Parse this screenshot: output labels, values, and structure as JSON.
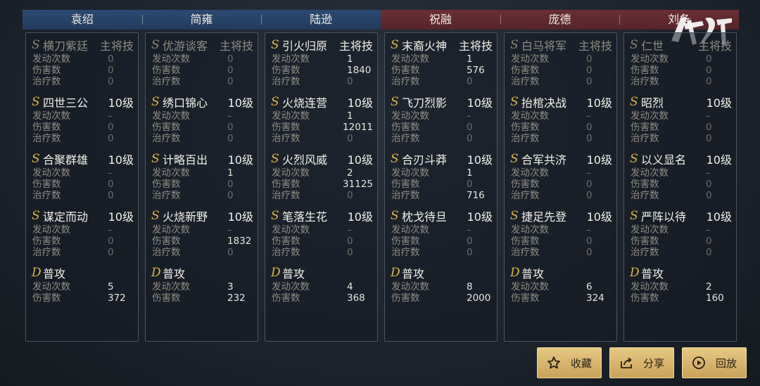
{
  "header": {
    "team_a": [
      "袁绍",
      "简雍",
      "陆逊"
    ],
    "team_b": [
      "祝融",
      "庞德",
      "刘备"
    ]
  },
  "columns": [
    {
      "skills": [
        {
          "grade": "S",
          "name": "横刀紫廷",
          "level": "主将技",
          "dim": true,
          "stats": [
            [
              "发动次数",
              "0"
            ],
            [
              "伤害数",
              "0"
            ],
            [
              "治疗数",
              "0"
            ]
          ]
        },
        {
          "grade": "S",
          "name": "四世三公",
          "level": "10级",
          "dim": false,
          "stats": [
            [
              "发动次数",
              "–"
            ],
            [
              "伤害数",
              "0"
            ],
            [
              "治疗数",
              "0"
            ]
          ]
        },
        {
          "grade": "S",
          "name": "合聚群雄",
          "level": "10级",
          "dim": false,
          "stats": [
            [
              "发动次数",
              "–"
            ],
            [
              "伤害数",
              "0"
            ],
            [
              "治疗数",
              "0"
            ]
          ]
        },
        {
          "grade": "S",
          "name": "谋定而动",
          "level": "10级",
          "dim": false,
          "stats": [
            [
              "发动次数",
              "–"
            ],
            [
              "伤害数",
              "0"
            ],
            [
              "治疗数",
              "0"
            ]
          ]
        },
        {
          "grade": "D",
          "name": "普攻",
          "level": "",
          "dim": false,
          "stats": [
            [
              "发动次数",
              "5"
            ],
            [
              "伤害数",
              "372"
            ]
          ]
        }
      ]
    },
    {
      "skills": [
        {
          "grade": "S",
          "name": "优游谈客",
          "level": "主将技",
          "dim": true,
          "stats": [
            [
              "发动次数",
              "0"
            ],
            [
              "伤害数",
              "0"
            ],
            [
              "治疗数",
              "0"
            ]
          ]
        },
        {
          "grade": "S",
          "name": "绣口锦心",
          "level": "10级",
          "dim": false,
          "stats": [
            [
              "发动次数",
              "–"
            ],
            [
              "伤害数",
              "0"
            ],
            [
              "治疗数",
              "0"
            ]
          ]
        },
        {
          "grade": "S",
          "name": "计略百出",
          "level": "10级",
          "dim": false,
          "stats": [
            [
              "发动次数",
              "1"
            ],
            [
              "伤害数",
              "0"
            ],
            [
              "治疗数",
              "0"
            ]
          ]
        },
        {
          "grade": "S",
          "name": "火烧新野",
          "level": "10级",
          "dim": false,
          "stats": [
            [
              "发动次数",
              "–"
            ],
            [
              "伤害数",
              "1832"
            ],
            [
              "治疗数",
              "0"
            ]
          ]
        },
        {
          "grade": "D",
          "name": "普攻",
          "level": "",
          "dim": false,
          "stats": [
            [
              "发动次数",
              "3"
            ],
            [
              "伤害数",
              "232"
            ]
          ]
        }
      ]
    },
    {
      "skills": [
        {
          "grade": "S",
          "name": "引火归原",
          "level": "主将技",
          "dim": false,
          "stats": [
            [
              "发动次数",
              "1"
            ],
            [
              "伤害数",
              "1840"
            ],
            [
              "治疗数",
              "0"
            ]
          ]
        },
        {
          "grade": "S",
          "name": "火烧连营",
          "level": "10级",
          "dim": false,
          "stats": [
            [
              "发动次数",
              "1"
            ],
            [
              "伤害数",
              "12011"
            ],
            [
              "治疗数",
              "0"
            ]
          ]
        },
        {
          "grade": "S",
          "name": "火烈风威",
          "level": "10级",
          "dim": false,
          "stats": [
            [
              "发动次数",
              "2"
            ],
            [
              "伤害数",
              "31125"
            ],
            [
              "治疗数",
              "0"
            ]
          ]
        },
        {
          "grade": "S",
          "name": "笔落生花",
          "level": "10级",
          "dim": false,
          "stats": [
            [
              "发动次数",
              "–"
            ],
            [
              "伤害数",
              "0"
            ],
            [
              "治疗数",
              "0"
            ]
          ]
        },
        {
          "grade": "D",
          "name": "普攻",
          "level": "",
          "dim": false,
          "stats": [
            [
              "发动次数",
              "4"
            ],
            [
              "伤害数",
              "368"
            ]
          ]
        }
      ]
    },
    {
      "skills": [
        {
          "grade": "S",
          "name": "末裔火神",
          "level": "主将技",
          "dim": false,
          "stats": [
            [
              "发动次数",
              "1"
            ],
            [
              "伤害数",
              "576"
            ],
            [
              "治疗数",
              "0"
            ]
          ]
        },
        {
          "grade": "S",
          "name": "飞刀烈影",
          "level": "10级",
          "dim": false,
          "stats": [
            [
              "发动次数",
              "–"
            ],
            [
              "伤害数",
              "0"
            ],
            [
              "治疗数",
              "0"
            ]
          ]
        },
        {
          "grade": "S",
          "name": "合刃斗莽",
          "level": "10级",
          "dim": false,
          "stats": [
            [
              "发动次数",
              "1"
            ],
            [
              "伤害数",
              "0"
            ],
            [
              "治疗数",
              "716"
            ]
          ]
        },
        {
          "grade": "S",
          "name": "枕戈待旦",
          "level": "10级",
          "dim": false,
          "stats": [
            [
              "发动次数",
              "–"
            ],
            [
              "伤害数",
              "0"
            ],
            [
              "治疗数",
              "0"
            ]
          ]
        },
        {
          "grade": "D",
          "name": "普攻",
          "level": "",
          "dim": false,
          "stats": [
            [
              "发动次数",
              "8"
            ],
            [
              "伤害数",
              "2000"
            ]
          ]
        }
      ]
    },
    {
      "skills": [
        {
          "grade": "S",
          "name": "白马将军",
          "level": "主将技",
          "dim": true,
          "stats": [
            [
              "发动次数",
              "0"
            ],
            [
              "伤害数",
              "0"
            ],
            [
              "治疗数",
              "0"
            ]
          ]
        },
        {
          "grade": "S",
          "name": "抬棺决战",
          "level": "10级",
          "dim": false,
          "stats": [
            [
              "发动次数",
              "–"
            ],
            [
              "伤害数",
              "0"
            ],
            [
              "治疗数",
              "0"
            ]
          ]
        },
        {
          "grade": "S",
          "name": "合军共济",
          "level": "10级",
          "dim": false,
          "stats": [
            [
              "发动次数",
              "–"
            ],
            [
              "伤害数",
              "0"
            ],
            [
              "治疗数",
              "0"
            ]
          ]
        },
        {
          "grade": "S",
          "name": "捷足先登",
          "level": "10级",
          "dim": false,
          "stats": [
            [
              "发动次数",
              "–"
            ],
            [
              "伤害数",
              "0"
            ],
            [
              "治疗数",
              "0"
            ]
          ]
        },
        {
          "grade": "D",
          "name": "普攻",
          "level": "",
          "dim": false,
          "stats": [
            [
              "发动次数",
              "6"
            ],
            [
              "伤害数",
              "324"
            ]
          ]
        }
      ]
    },
    {
      "skills": [
        {
          "grade": "S",
          "name": "仁世",
          "level": "主将技",
          "dim": true,
          "stats": [
            [
              "发动次数",
              "0"
            ],
            [
              "伤害数",
              "0"
            ],
            [
              "治疗数",
              "0"
            ]
          ]
        },
        {
          "grade": "S",
          "name": "昭烈",
          "level": "10级",
          "dim": false,
          "stats": [
            [
              "发动次数",
              "–"
            ],
            [
              "伤害数",
              "0"
            ],
            [
              "治疗数",
              "0"
            ]
          ]
        },
        {
          "grade": "S",
          "name": "以义显名",
          "level": "10级",
          "dim": false,
          "stats": [
            [
              "发动次数",
              "–"
            ],
            [
              "伤害数",
              "0"
            ],
            [
              "治疗数",
              "0"
            ]
          ]
        },
        {
          "grade": "S",
          "name": "严阵以待",
          "level": "10级",
          "dim": false,
          "stats": [
            [
              "发动次数",
              "–"
            ],
            [
              "伤害数",
              "0"
            ],
            [
              "治疗数",
              "0"
            ]
          ]
        },
        {
          "grade": "D",
          "name": "普攻",
          "level": "",
          "dim": false,
          "stats": [
            [
              "发动次数",
              "2"
            ],
            [
              "伤害数",
              "160"
            ]
          ]
        }
      ]
    }
  ],
  "buttons": {
    "favorite": "收藏",
    "share": "分享",
    "replay": "回放"
  },
  "watermark": "鸿图讯",
  "colors": {
    "team_a": "#2c4a72",
    "team_b": "#6b2f35",
    "grade_gold": "#d9b64b",
    "button_gold": "#d8b46e"
  }
}
